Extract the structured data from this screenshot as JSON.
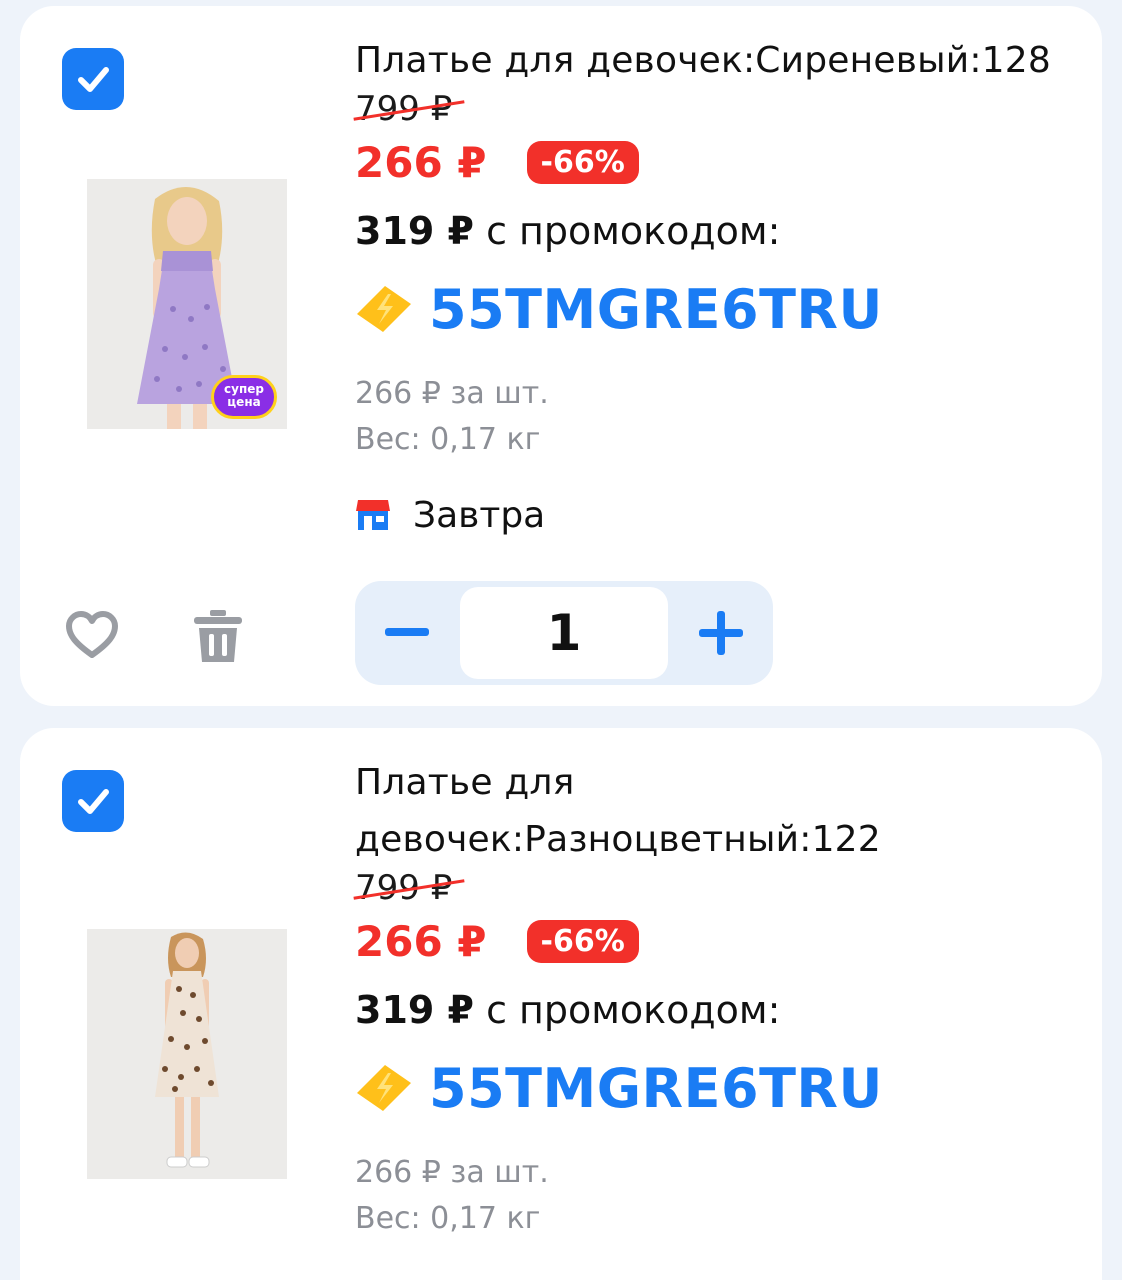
{
  "items": [
    {
      "title": "Платье для девочек:Сиреневый:128",
      "old_price": "799 ₽",
      "price": "266 ₽",
      "discount": "-66%",
      "promo_price": "319 ₽",
      "promo_text": " с промокодом:",
      "promo_code": "55TMGRE6TRU",
      "unit_price": "266 ₽ за шт.",
      "weight": "Вес: 0,17 кг",
      "delivery": "Завтра",
      "quantity": "1",
      "badge_line1": "супер",
      "badge_line2": "цена",
      "checked": true
    },
    {
      "title_line1": "Платье для",
      "title_line2": "девочек:Разноцветный:122",
      "old_price": "799 ₽",
      "price": "266 ₽",
      "discount": "-66%",
      "promo_price": "319 ₽",
      "promo_text": " с промокодом:",
      "promo_code": "55TMGRE6TRU",
      "unit_price": "266 ₽ за шт.",
      "weight": "Вес: 0,17 кг",
      "checked": true
    }
  ],
  "colors": {
    "accent_blue": "#1a7cf4",
    "sale_red": "#f2302a",
    "promo_yellow": "#ffc01a",
    "muted_gray": "#8c8f96",
    "background": "#eef3fa"
  },
  "icons": {
    "checkbox": "check-icon",
    "promo": "lightning-ticket-icon",
    "delivery": "store-icon",
    "favorite": "heart-icon",
    "delete": "trash-icon",
    "decrease": "minus-icon",
    "increase": "plus-icon"
  }
}
